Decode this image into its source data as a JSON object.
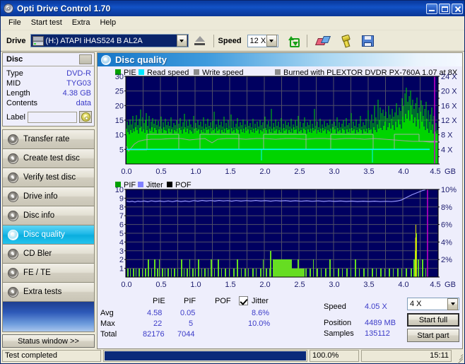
{
  "window": {
    "title": "Opti Drive Control 1.70",
    "icon": "disc-icon",
    "minimize": "minimize",
    "maximize": "maximize",
    "close": "close"
  },
  "menu": [
    {
      "label": "File"
    },
    {
      "label": "Start test"
    },
    {
      "label": "Extra"
    },
    {
      "label": "Help"
    }
  ],
  "toolbar": {
    "drive_label": "Drive",
    "drive_value": "(H:)   ATAPI iHAS524  B AL2A",
    "eject_label": "eject-button",
    "speed_label": "Speed",
    "speed_value": "12 X",
    "refresh_label": "refresh-button",
    "erase_label": "erase-button",
    "tools_label": "tools-button",
    "save_label": "save-button"
  },
  "disc": {
    "header": "Disc",
    "rows": [
      {
        "key": "Type",
        "value": "DVD-R"
      },
      {
        "key": "MID",
        "value": "TYG03"
      },
      {
        "key": "Length",
        "value": "4.38 GB"
      },
      {
        "key": "Contents",
        "value": "data"
      }
    ],
    "label_key": "Label",
    "label_value": ""
  },
  "nav": {
    "items": [
      {
        "label": "Transfer rate",
        "active": false
      },
      {
        "label": "Create test disc",
        "active": false
      },
      {
        "label": "Verify test disc",
        "active": false
      },
      {
        "label": "Drive info",
        "active": false
      },
      {
        "label": "Disc info",
        "active": false
      },
      {
        "label": "Disc quality",
        "active": true
      },
      {
        "label": "CD Bler",
        "active": false
      },
      {
        "label": "FE / TE",
        "active": false
      },
      {
        "label": "Extra tests",
        "active": false
      }
    ],
    "status_button": "Status window >>"
  },
  "panel": {
    "title": "Disc quality"
  },
  "stats": {
    "col_pie": "PIE",
    "col_pif": "PIF",
    "col_pof": "POF",
    "jitter_label": "Jitter",
    "jitter_checked": true,
    "row_avg": "Avg",
    "row_max": "Max",
    "row_total": "Total",
    "avg_pie": "4.58",
    "avg_pif": "0.05",
    "avg_pof": "",
    "avg_jitter": "8.6%",
    "max_pie": "22",
    "max_pif": "5",
    "max_pof": "",
    "max_jitter": "10.0%",
    "total_pie": "82176",
    "total_pif": "7044",
    "speed_label": "Speed",
    "speed_value": "4.05 X",
    "position_label": "Position",
    "position_value": "4489 MB",
    "samples_label": "Samples",
    "samples_value": "135112",
    "speed_select": "4 X",
    "start_full": "Start full",
    "start_part": "Start part"
  },
  "statusbar": {
    "message": "Test completed",
    "progress_percent": 100.0,
    "progress_text": "100.0%",
    "time": "15:11"
  },
  "chart_data": [
    {
      "type": "area",
      "name": "pie-chart",
      "title": "",
      "xlabel": "GB",
      "ylabel": "",
      "xlim": [
        0,
        4.5
      ],
      "ylim": [
        0,
        30
      ],
      "y2lim": [
        0,
        24
      ],
      "y2label": "X",
      "xticks": [
        "0.0",
        "0.5",
        "1.0",
        "1.5",
        "2.0",
        "2.5",
        "3.0",
        "3.5",
        "4.0",
        "4.5"
      ],
      "xtick_suffix": "GB",
      "yticks": [
        5,
        10,
        15,
        20,
        25,
        30
      ],
      "y2ticks": [
        "4 X",
        "8 X",
        "12 X",
        "16 X",
        "20 X",
        "24 X"
      ],
      "grid": true,
      "background": "#000060",
      "legend_position": "top",
      "legend": [
        {
          "label": "PIE",
          "color": "#00a000"
        },
        {
          "label": "Read speed",
          "color": "#00ffff"
        },
        {
          "label": "Write speed",
          "color": "#8c8c8c"
        },
        {
          "label": "Burned with PLEXTOR DVDR   PX-760A 1.07 at 8X",
          "color": "#8c8c8c"
        }
      ],
      "series": [
        {
          "name": "PIE",
          "color": "#00d000",
          "type": "area",
          "baseline_level": 9.5,
          "peak_max": 22
        },
        {
          "name": "Read speed",
          "color": "#00ffff",
          "type": "line",
          "level": 5.0
        },
        {
          "name": "Write speed",
          "color": "#8c8c8c",
          "type": "step",
          "start_level": 8.0,
          "end_level": 7.2
        }
      ],
      "end_marker": {
        "color": "#cc00cc",
        "x": 4.45
      }
    },
    {
      "type": "bar",
      "name": "pif-jitter-chart",
      "title": "",
      "xlabel": "GB",
      "ylabel": "",
      "xlim": [
        0,
        4.5
      ],
      "ylim": [
        0,
        10
      ],
      "y2lim": [
        0,
        10
      ],
      "y2label": "%",
      "xticks": [
        "0.0",
        "0.5",
        "1.0",
        "1.5",
        "2.0",
        "2.5",
        "3.0",
        "3.5",
        "4.0",
        "4.5"
      ],
      "xtick_suffix": "GB",
      "yticks": [
        1,
        2,
        3,
        4,
        5,
        6,
        7,
        8,
        9,
        10
      ],
      "y2ticks": [
        "2%",
        "4%",
        "6%",
        "8%",
        "10%"
      ],
      "grid": true,
      "background": "#000060",
      "legend_position": "top",
      "legend": [
        {
          "label": "PIF",
          "color": "#00a000"
        },
        {
          "label": "Jitter",
          "color": "#8080ff"
        },
        {
          "label": "POF",
          "color": "#000000"
        }
      ],
      "series": [
        {
          "name": "PIF",
          "color": "#66dd22",
          "type": "bar",
          "typical": 1,
          "max": 5
        },
        {
          "name": "Jitter",
          "color": "#9999ff",
          "type": "line",
          "start": 8.7,
          "mid": 8.6,
          "end": 10.0
        }
      ],
      "end_marker": {
        "color": "#cc00cc",
        "x": 4.37
      }
    }
  ]
}
